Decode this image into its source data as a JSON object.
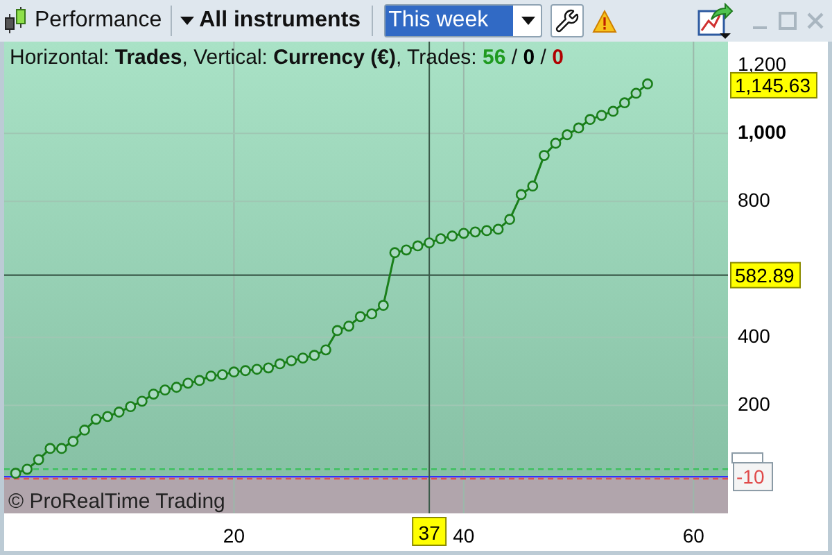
{
  "toolbar": {
    "title": "Performance",
    "instrument_menu": "All instruments",
    "period_select": {
      "value": "This week"
    }
  },
  "info": {
    "text": "Horizontal: **Trades**, Vertical: **Currency (€)**, Trades: ",
    "separator": "/",
    "counts": [
      {
        "value": "56",
        "color": "#1f9a1f"
      },
      {
        "value": "0",
        "color": "#000000"
      },
      {
        "value": "0",
        "color": "#b00000"
      }
    ]
  },
  "chart": {
    "copyright": "© ProRealTime Trading",
    "crosshair": {
      "x_label": "37",
      "y_label": "582.89"
    },
    "last_value_label": "1,145.63",
    "baseline_label": "-10",
    "chart_data": {
      "type": "line",
      "x": [
        1,
        2,
        3,
        4,
        5,
        6,
        7,
        8,
        9,
        10,
        11,
        12,
        13,
        14,
        15,
        16,
        17,
        18,
        19,
        20,
        21,
        22,
        23,
        24,
        25,
        26,
        27,
        28,
        29,
        30,
        31,
        32,
        33,
        34,
        35,
        36,
        37,
        38,
        39,
        40,
        41,
        42,
        43,
        44,
        45,
        46,
        47,
        48,
        49,
        50,
        51,
        52,
        53,
        54,
        55,
        56
      ],
      "series": [
        {
          "color": "#1a7f1a",
          "values": [
            0,
            12,
            40,
            73,
            73,
            94,
            127,
            159,
            167,
            180,
            196,
            212,
            233,
            245,
            253,
            265,
            273,
            286,
            290,
            298,
            302,
            306,
            310,
            322,
            331,
            339,
            347,
            363,
            420,
            433,
            461,
            469,
            494,
            649,
            657,
            669,
            678,
            690,
            698,
            706,
            710,
            714,
            718,
            747,
            820,
            845,
            935,
            971,
            996,
            1016,
            1041,
            1053,
            1065,
            1090,
            1118,
            1145.63
          ],
          "marker": "o"
        }
      ],
      "grid": true,
      "ref_lines": [
        {
          "axis": "y",
          "value": 12,
          "color": "#3fbf5f"
        },
        {
          "axis": "y",
          "value": -16,
          "color": "#e05050"
        },
        {
          "axis": "x",
          "value": 37,
          "color": "#3b5a4a"
        },
        {
          "axis": "y",
          "value": 582.89,
          "color": "#3b5a4a"
        }
      ],
      "xlim": [
        0,
        63
      ],
      "ylim": [
        -118,
        1270
      ],
      "xticks": [
        20,
        40,
        60
      ],
      "yticks": [
        200,
        400,
        800,
        {
          "value": 1000,
          "label": "1,000"
        },
        {
          "value": 1200,
          "label": "1,200"
        }
      ]
    }
  }
}
